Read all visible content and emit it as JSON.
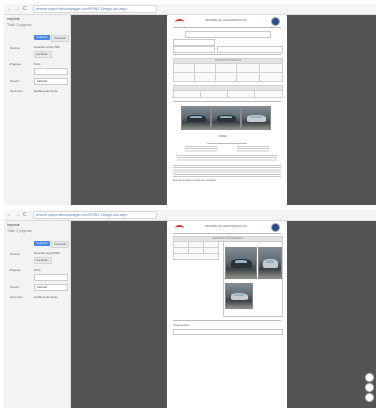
{
  "screenshots": [
    {
      "browser": {
        "nav_back": "←",
        "nav_forward": "→",
        "nav_reload": "C",
        "url": "dmvnet.mayor.bibliomanager.com/PRINT: Design doc.aspx"
      },
      "print_panel": {
        "title": "Imprimir",
        "subtitle": "Total: 2 páginas",
        "print_button": "Imprimir",
        "cancel_button": "Cancelar",
        "destination_label": "Destino",
        "destination_value": "Guardar como PDF",
        "change_button": "Cambiar...",
        "pages_label": "Páginas",
        "pages_value": "Todo",
        "layout_label": "Diseño",
        "layout_value": "Vertical",
        "options_label": "Opciones",
        "options_value": "Gráficos de fondo"
      },
      "document": {
        "header_title": "INFORME DE CARACTERIZACIÓN",
        "section_title": "VALORACIÓN TÉCNICA",
        "signature_label": "FIRMA",
        "footer_note": "Este documento es para uso exclusivo"
      }
    },
    {
      "browser": {
        "nav_back": "←",
        "nav_forward": "→",
        "nav_reload": "C",
        "url": "dmvnet.mayor.bibliomanager.com/PRINT: Design doc.aspx"
      },
      "print_panel": {
        "title": "Imprimir",
        "subtitle": "Total: 2 páginas",
        "print_button": "Imprimir",
        "cancel_button": "Cancelar",
        "destination_label": "Destino",
        "destination_value": "Guardar como PDF",
        "change_button": "Cambiar...",
        "pages_label": "Páginas",
        "pages_value": "Todo",
        "layout_label": "Diseño",
        "layout_value": "Vertical",
        "options_label": "Opciones",
        "options_value": "Gráficos de fondo"
      },
      "document": {
        "header_title": "INFORME DE CARACTERIZACIÓN",
        "section_title": "REGISTRO FOTOGRÁFICO",
        "footer_note": "Observaciones"
      }
    }
  ],
  "colors": {
    "accent": "#4a86e8",
    "viewer_bg": "#545454",
    "logo_red": "#dd3333",
    "seal_blue": "#2b4c8c"
  },
  "icons": [
    "zoom-fit-icon",
    "zoom-in-icon",
    "zoom-out-icon"
  ]
}
